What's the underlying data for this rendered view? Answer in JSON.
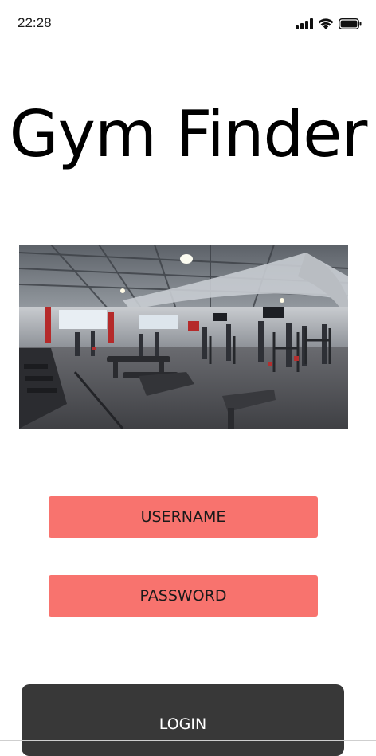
{
  "status_bar": {
    "time": "22:28",
    "icons": [
      "signal-icon",
      "wifi-icon",
      "battery-icon"
    ]
  },
  "app": {
    "title": "Gym Finder"
  },
  "hero": {
    "alt": "Gym interior with weight benches and racks"
  },
  "login_form": {
    "username_placeholder": "USERNAME",
    "password_placeholder": "PASSWORD",
    "login_label": "LOGIN"
  },
  "colors": {
    "field_bg": "#f8736e",
    "button_bg": "#383838",
    "button_text": "#ffffff"
  }
}
